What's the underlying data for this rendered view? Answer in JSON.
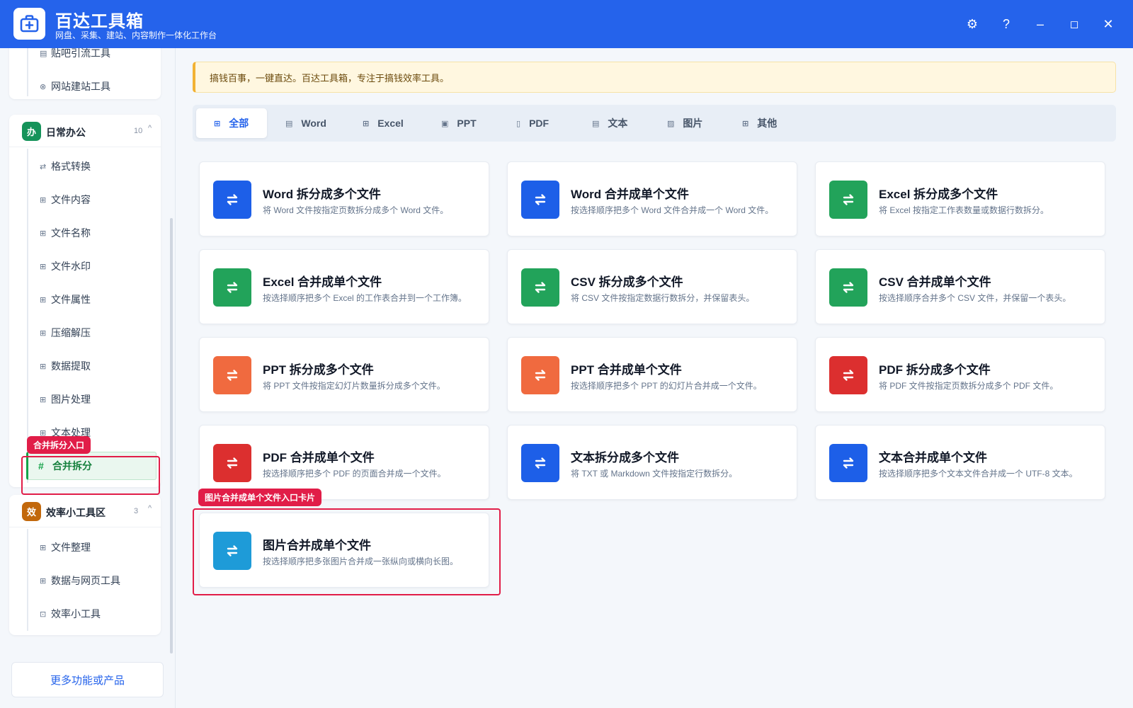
{
  "app": {
    "title": "百达工具箱",
    "subtitle": "网盘、采集、建站、内容制作一体化工作台",
    "brand_color": "#2563eb"
  },
  "window_controls": [
    {
      "name": "settings-icon",
      "glyph": "⚙"
    },
    {
      "name": "help-icon",
      "glyph": "?"
    },
    {
      "name": "minimize-icon",
      "glyph": "–"
    },
    {
      "name": "maximize-icon",
      "glyph": "◻"
    },
    {
      "name": "close-icon",
      "glyph": "✕"
    }
  ],
  "sidebar": {
    "top_items": [
      {
        "icon": "▤",
        "label": "贴吧引流工具"
      },
      {
        "icon": "⊗",
        "label": "网站建站工具"
      }
    ],
    "groups": [
      {
        "badge": "办",
        "badge_color": "#15935a",
        "title": "日常办公",
        "count": "10",
        "caret": "^",
        "items": [
          {
            "icon": "⇄",
            "label": "格式转换"
          },
          {
            "icon": "⊞",
            "label": "文件内容"
          },
          {
            "icon": "⊞",
            "label": "文件名称"
          },
          {
            "icon": "⊞",
            "label": "文件水印"
          },
          {
            "icon": "⊞",
            "label": "文件属性"
          },
          {
            "icon": "⊞",
            "label": "压缩解压"
          },
          {
            "icon": "⊞",
            "label": "数据提取"
          },
          {
            "icon": "⊞",
            "label": "图片处理"
          },
          {
            "icon": "⊞",
            "label": "文本处理"
          },
          {
            "icon": "#",
            "label": "合并拆分",
            "active": true
          }
        ]
      },
      {
        "badge": "效",
        "badge_color": "#c2680c",
        "title": "效率小工具区",
        "count": "3",
        "caret": "^",
        "items": [
          {
            "icon": "⊞",
            "label": "文件整理"
          },
          {
            "icon": "⊞",
            "label": "数据与网页工具"
          },
          {
            "icon": "⊡",
            "label": "效率小工具"
          }
        ]
      }
    ],
    "more_button": "更多功能或产品",
    "callout": "合并拆分入口"
  },
  "notice": "搞钱百事，一键直达。百达工具箱，专注于搞钱效率工具。",
  "tabs": [
    {
      "icon": "⊞",
      "label": "全部",
      "active": true
    },
    {
      "icon": "▤",
      "label": "Word"
    },
    {
      "icon": "⊞",
      "label": "Excel"
    },
    {
      "icon": "▣",
      "label": "PPT"
    },
    {
      "icon": "▯",
      "label": "PDF"
    },
    {
      "icon": "▤",
      "label": "文本"
    },
    {
      "icon": "▨",
      "label": "图片"
    },
    {
      "icon": "⊞",
      "label": "其他"
    }
  ],
  "cards": [
    {
      "title": "Word 拆分成多个文件",
      "desc": "将 Word 文件按指定页数拆分成多个 Word 文件。",
      "color": "#1d5fe8"
    },
    {
      "title": "Word 合并成单个文件",
      "desc": "按选择顺序把多个 Word 文件合并成一个 Word 文件。",
      "color": "#1d5fe8"
    },
    {
      "title": "Excel 拆分成多个文件",
      "desc": "将 Excel 按指定工作表数量或数据行数拆分。",
      "color": "#22a35a"
    },
    {
      "title": "Excel 合并成单个文件",
      "desc": "按选择顺序把多个 Excel 的工作表合并到一个工作簿。",
      "color": "#22a35a"
    },
    {
      "title": "CSV 拆分成多个文件",
      "desc": "将 CSV 文件按指定数据行数拆分，并保留表头。",
      "color": "#22a35a"
    },
    {
      "title": "CSV 合并成单个文件",
      "desc": "按选择顺序合并多个 CSV 文件，并保留一个表头。",
      "color": "#22a35a"
    },
    {
      "title": "PPT 拆分成多个文件",
      "desc": "将 PPT 文件按指定幻灯片数量拆分成多个文件。",
      "color": "#f06a3f"
    },
    {
      "title": "PPT 合并成单个文件",
      "desc": "按选择顺序把多个 PPT 的幻灯片合并成一个文件。",
      "color": "#f06a3f"
    },
    {
      "title": "PDF 拆分成多个文件",
      "desc": "将 PDF 文件按指定页数拆分成多个 PDF 文件。",
      "color": "#dc2f2f"
    },
    {
      "title": "PDF 合并成单个文件",
      "desc": "按选择顺序把多个 PDF 的页面合并成一个文件。",
      "color": "#dc2f2f"
    },
    {
      "title": "文本拆分成多个文件",
      "desc": "将 TXT 或 Markdown 文件按指定行数拆分。",
      "color": "#1d5fe8"
    },
    {
      "title": "文本合并成单个文件",
      "desc": "按选择顺序把多个文本文件合并成一个 UTF-8 文本。",
      "color": "#1d5fe8"
    },
    {
      "title": "图片合并成单个文件",
      "desc": "按选择顺序把多张图片合并成一张纵向或横向长图。",
      "color": "#1e9bd8"
    }
  ],
  "card_callout": "图片合并成单个文件入口卡片"
}
